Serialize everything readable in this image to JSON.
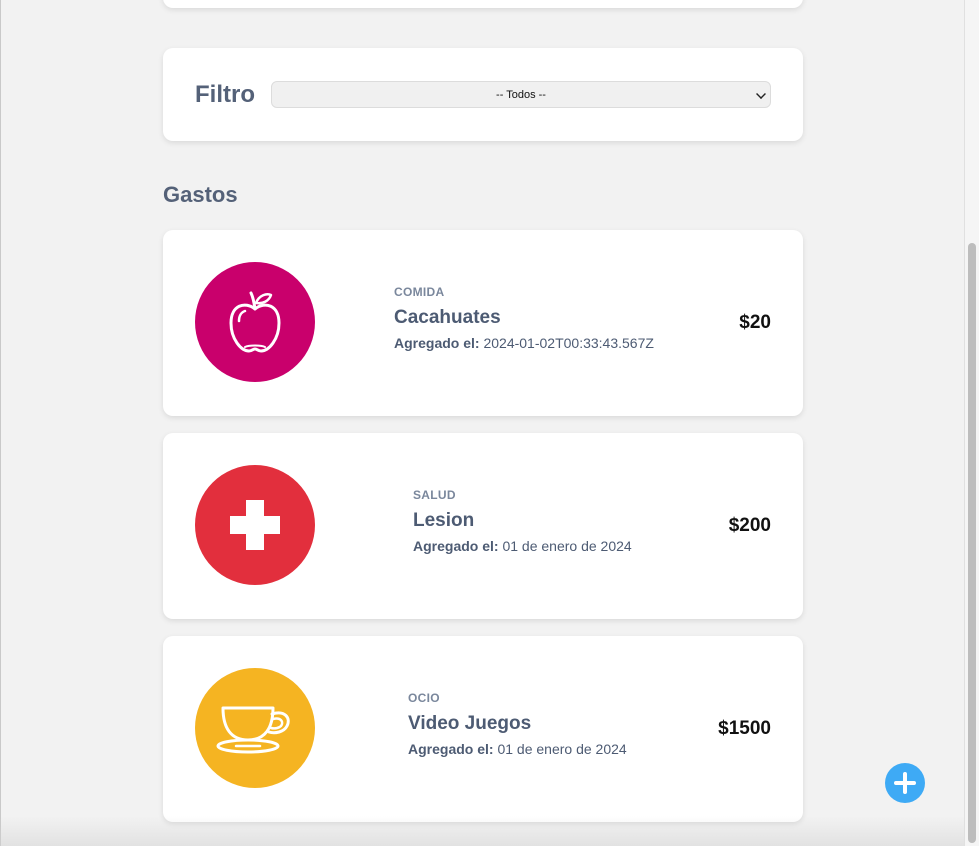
{
  "filter": {
    "label": "Filtro",
    "selected": "-- Todos --"
  },
  "section_title": "Gastos",
  "expenses": [
    {
      "category": "COMIDA",
      "name": "Cacahuates",
      "date_label": "Agregado el:",
      "date": "2024-01-02T00:33:43.567Z",
      "amount": "$20",
      "icon": "apple-icon",
      "color": "#c9006c"
    },
    {
      "category": "SALUD",
      "name": "Lesion",
      "date_label": "Agregado el:",
      "date": "01 de enero de 2024",
      "amount": "$200",
      "icon": "medical-cross-icon",
      "color": "#e22f3d"
    },
    {
      "category": "OCIO",
      "name": "Video Juegos",
      "date_label": "Agregado el:",
      "date": "01 de enero de 2024",
      "amount": "$1500",
      "icon": "coffee-cup-icon",
      "color": "#f5b422"
    }
  ],
  "fab": {
    "icon": "plus-icon",
    "color": "#3eaaf5"
  }
}
